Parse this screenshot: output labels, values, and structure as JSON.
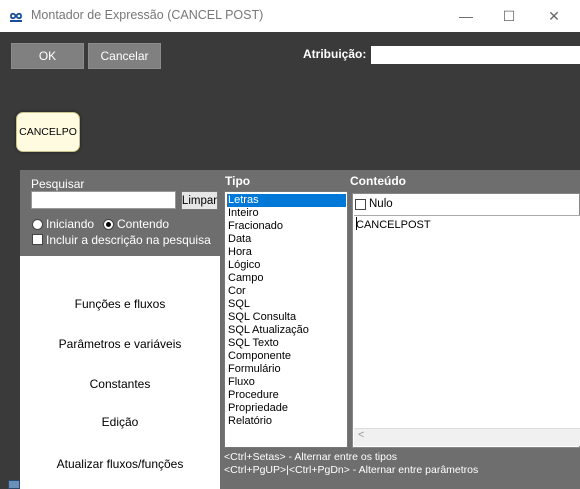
{
  "window": {
    "title": "Montador de Expressão (CANCEL POST)",
    "icon": "infinity-app-icon",
    "controls": {
      "minimize": "—",
      "maximize": "☐",
      "close": "✕"
    }
  },
  "toolbar": {
    "ok_label": "OK",
    "cancel_label": "Cancelar",
    "assignment_label": "Atribuição:",
    "assignment_value": ""
  },
  "expression": {
    "token_label": "CANCELPO"
  },
  "search": {
    "label": "Pesquisar",
    "value": "",
    "clear_label": "Limpar",
    "options": [
      {
        "label": "Iniciando",
        "selected": false
      },
      {
        "label": "Contendo",
        "selected": true
      }
    ],
    "include_description_label": "Incluir a descrição na pesquisa",
    "include_description_checked": false
  },
  "menu": {
    "items": [
      "Funções e fluxos",
      "Parâmetros e variáveis",
      "Constantes",
      "Edição",
      "Atualizar fluxos/funções"
    ]
  },
  "types": {
    "header": "Tipo",
    "selected_index": 0,
    "items": [
      "Letras",
      "Inteiro",
      "Fracionado",
      "Data",
      "Hora",
      "Lógico",
      "Campo",
      "Cor",
      "SQL",
      "SQL Consulta",
      "SQL Atualização",
      "SQL Texto",
      "Componente",
      "Formulário",
      "Fluxo",
      "Procedure",
      "Propriedade",
      "Relatório"
    ]
  },
  "content": {
    "header": "Conteúdo",
    "null_label": "Nulo",
    "null_checked": false,
    "value": "CANCELPOST"
  },
  "hints": {
    "line1": "<Ctrl+Setas> - Alternar entre os tipos",
    "line2": "<Ctrl+PgUP>|<Ctrl+PgDn> - Alternar entre parâmetros"
  },
  "colors": {
    "background": "#3a3a3a",
    "panel": "#6e6e6e",
    "selection": "#0078d7",
    "token_fill": "#fffbe0"
  }
}
